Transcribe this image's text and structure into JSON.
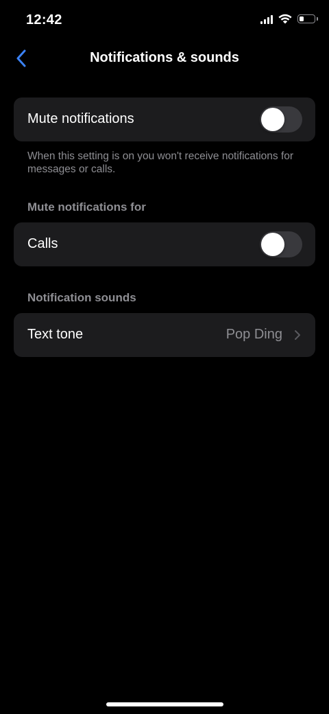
{
  "status_bar": {
    "time": "12:42",
    "icons": [
      "cellular-signal-icon",
      "wifi-icon",
      "battery-icon"
    ],
    "battery_level": 0.3
  },
  "nav": {
    "title": "Notifications & sounds",
    "back_icon": "chevron-left-icon",
    "accent_color": "#3b82f6"
  },
  "mute_notifications": {
    "label": "Mute notifications",
    "enabled": false,
    "description": "When this setting is on you won't receive notifications for messages or calls."
  },
  "mute_notifications_for": {
    "header": "Mute notifications for",
    "items": [
      {
        "label": "Calls",
        "enabled": false
      }
    ]
  },
  "notification_sounds": {
    "header": "Notification sounds",
    "items": [
      {
        "label": "Text tone",
        "value": "Pop Ding",
        "icon": "chevron-right-icon"
      }
    ]
  },
  "colors": {
    "background": "#000000",
    "cell_background": "#1c1c1e",
    "secondary_text": "#8e8e93",
    "toggle_off_track": "#39393d"
  }
}
